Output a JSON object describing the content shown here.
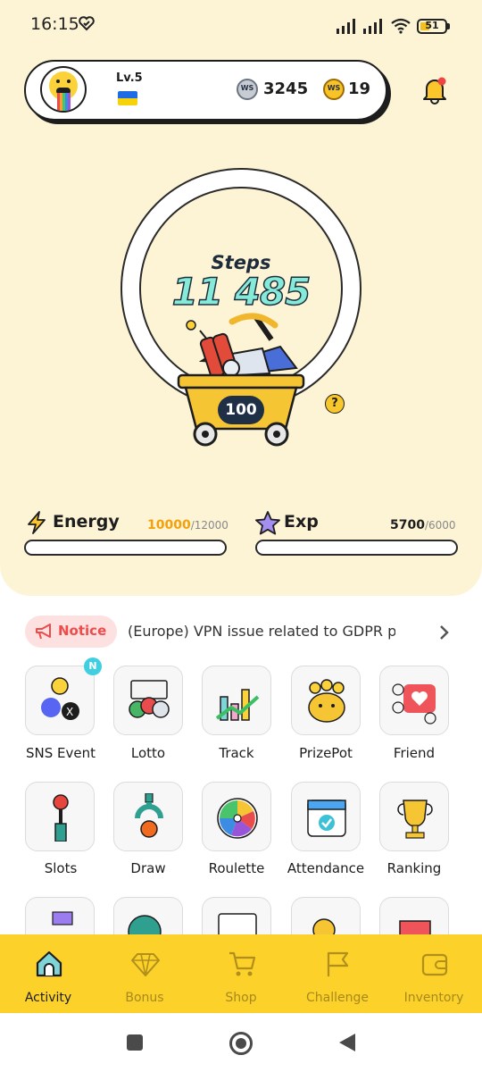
{
  "status": {
    "time": "16:15",
    "battery": "51"
  },
  "profile": {
    "level": "Lv.5",
    "coin_silver_icon": "WS",
    "coin_silver": "3245",
    "coin_gold_icon": "WS",
    "coin_gold": "19"
  },
  "steps": {
    "label": "Steps",
    "value": "11 485",
    "cart_value": "100",
    "help": "?"
  },
  "energy": {
    "label": "Energy",
    "value": "10000",
    "max": "/12000",
    "fill": 0
  },
  "exp": {
    "label": "Exp",
    "value": "5700",
    "max": "/6000",
    "fill": 0
  },
  "notice": {
    "label": "Notice",
    "text": "(Europe) VPN issue related to GDPR pol..."
  },
  "grid": [
    {
      "label": "SNS Event",
      "badge": "N"
    },
    {
      "label": "Lotto"
    },
    {
      "label": "Track"
    },
    {
      "label": "PrizePot"
    },
    {
      "label": "Friend"
    },
    {
      "label": "Slots"
    },
    {
      "label": "Draw"
    },
    {
      "label": "Roulette"
    },
    {
      "label": "Attendance"
    },
    {
      "label": "Ranking"
    }
  ],
  "nav": [
    {
      "label": "Activity",
      "icon": "home-icon",
      "active": true
    },
    {
      "label": "Bonus",
      "icon": "diamond-icon"
    },
    {
      "label": "Shop",
      "icon": "cart-icon"
    },
    {
      "label": "Challenge",
      "icon": "flag-icon"
    },
    {
      "label": "Inventory",
      "icon": "wallet-icon"
    }
  ],
  "colors": {
    "accent_yellow": "#fcd12a",
    "cream": "#fdf4d6",
    "steps_cyan": "#86ead9",
    "notice_red": "#ee4b4b"
  }
}
